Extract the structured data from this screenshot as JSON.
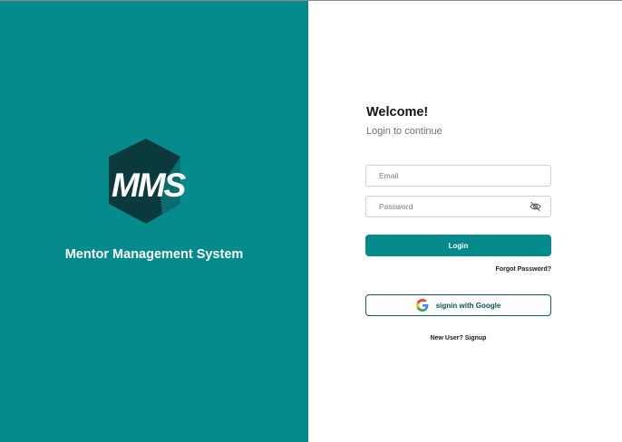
{
  "brand": {
    "logo_text": "MMS",
    "app_name": "Mentor Management System",
    "primary_color": "#058b8c",
    "logo_dark_color": "#0b3a3e"
  },
  "login": {
    "heading": "Welcome!",
    "subheading": "Login to continue",
    "email_placeholder": "Email",
    "email_value": "",
    "password_placeholder": "Password",
    "password_value": "",
    "password_toggle_icon": "eye-off-icon",
    "login_button_label": "Login",
    "forgot_password_label": "Forgot Password?",
    "google_button_label": "signin with Google",
    "google_icon": "google-icon",
    "signup_label": "New User? Signup"
  }
}
